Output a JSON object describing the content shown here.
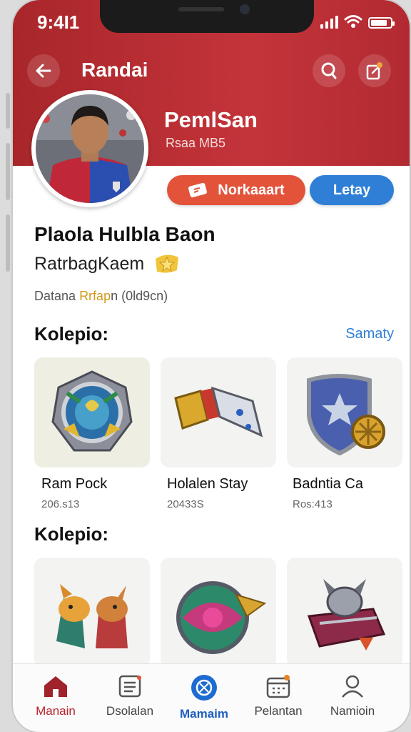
{
  "status_bar": {
    "time": "9:4I1"
  },
  "header": {
    "title": "Randai"
  },
  "profile": {
    "name": "PemlSan",
    "subtitle": "Rsaa MB5",
    "primary_action": "Norkaaart",
    "secondary_action": "Letay",
    "full_name": "Plaola Hulbla Baon",
    "rank": "RatrbagKaem",
    "meta_prefix": "Datana",
    "meta_accent": "Rrfap",
    "meta_suffix": "n (0ld9cn)"
  },
  "section1": {
    "title": "Kolepio:",
    "see_all": "Samaty",
    "items": [
      {
        "name": "Ram Pock",
        "sub": "206.s13",
        "icon": "emblem-icon"
      },
      {
        "name": "Holalen Stay",
        "sub": "20433S",
        "icon": "gauntlet-icon"
      },
      {
        "name": "Badntia Ca",
        "sub": "Ros:413",
        "icon": "shield-icon"
      }
    ]
  },
  "section2": {
    "title": "Kolepio:",
    "items": [
      {
        "icon": "dragons-icon"
      },
      {
        "icon": "orb-icon"
      },
      {
        "icon": "helmet-chest-icon"
      }
    ]
  },
  "nav": {
    "items": [
      {
        "label": "Manain",
        "icon": "home-icon"
      },
      {
        "label": "Dsolalan",
        "icon": "list-icon"
      },
      {
        "label": "Mamaim",
        "icon": "globe-icon"
      },
      {
        "label": "Pelantan",
        "icon": "calendar-icon"
      },
      {
        "label": "Namioin",
        "icon": "person-icon"
      }
    ]
  },
  "colors": {
    "header": "#b22a31",
    "accent_blue": "#2f7fd6",
    "accent_orange": "#e2533a"
  }
}
